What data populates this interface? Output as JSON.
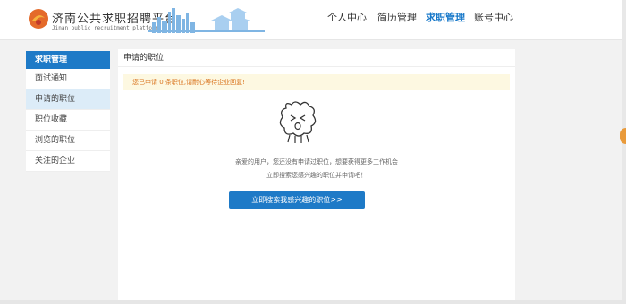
{
  "brand": {
    "title": "济南公共求职招聘平台",
    "subtitle": "Jinan public recruitment platform"
  },
  "nav": {
    "items": [
      {
        "label": "个人中心",
        "active": false
      },
      {
        "label": "简历管理",
        "active": false
      },
      {
        "label": "求职管理",
        "active": true
      },
      {
        "label": "账号中心",
        "active": false
      }
    ]
  },
  "sidebar": {
    "heading": "求职管理",
    "items": [
      {
        "label": "面试通知"
      },
      {
        "label": "申请的职位"
      },
      {
        "label": "职位收藏"
      },
      {
        "label": "浏览的职位"
      },
      {
        "label": "关注的企业"
      }
    ]
  },
  "main": {
    "title": "申请的职位",
    "notice": "您已申请 0 条职位,请耐心等待企业回复!",
    "empty_line1": "亲爱的用户，您还没有申请过职位，想要获得更多工作机会",
    "empty_line2": "立即搜索您感兴趣的职位并申请吧！",
    "button": "立即搜索我感兴趣的职位>>"
  },
  "colors": {
    "accent": "#1e7ac7",
    "notice_bg": "#fdf8e1",
    "notice_text": "#d9731d"
  }
}
